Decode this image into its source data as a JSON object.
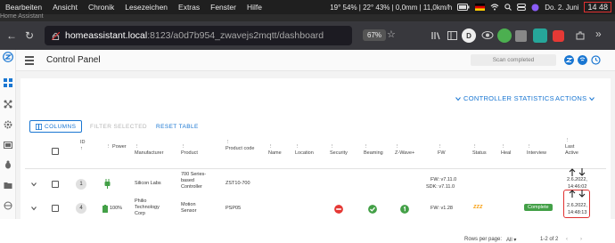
{
  "menubar": {
    "items": [
      "Bearbeiten",
      "Ansicht",
      "Chronik",
      "Lesezeichen",
      "Extras",
      "Fenster",
      "Hilfe"
    ],
    "status": "19° 54% | 22° 43% | 0,0mm | 11,0km/h",
    "date": "Do. 2. Juni",
    "time": "14 48"
  },
  "tab": {
    "title": "Home Assistant"
  },
  "browser": {
    "url_host": "homeassistant.local",
    "url_rest": ":8123/a0d7b954_zwavejs2mqtt/dashboard",
    "zoom": "67%",
    "ext_letter": "D"
  },
  "header": {
    "title": "Control Panel",
    "scan_status": "Scan completed"
  },
  "controls": {
    "stats_label": "CONTROLLER STATISTICS",
    "actions_label": "ACTIONS"
  },
  "toolbar": {
    "columns_label": "COLUMNS",
    "filter_label": "FILTER SELECTED",
    "reset_label": "RESET TABLE"
  },
  "table": {
    "headers": {
      "id": "ID",
      "power": "Power",
      "manufacturer": "Manufacturer",
      "product": "Product",
      "product_code": "Product code",
      "name": "Name",
      "location": "Location",
      "security": "Security",
      "beaming": "Beaming",
      "zwave_plus": "Z-Wave+",
      "fw": "FW",
      "status": "Status",
      "heal": "Heal",
      "interview": "Interview",
      "last_active": "Last Active"
    },
    "rows": [
      {
        "id": "1",
        "power": "",
        "manufacturer": "Silicon Labs",
        "product_l1": "700 Series-",
        "product_l2": "based",
        "product_l3": "Controller",
        "product_code": "ZST10-700",
        "fw_l1": "FW: v7.11.0",
        "fw_l2": "SDK: v7.11.0",
        "last_l1": "2.6.2022,",
        "last_l2": "14:46:02"
      },
      {
        "id": "4",
        "power": "100%",
        "manufacturer_l1": "Philio",
        "manufacturer_l2": "Technology",
        "manufacturer_l3": "Corp",
        "product_l1": "Motion",
        "product_l2": "Sensor",
        "product_code": "PSP05",
        "fw": "FW: v1.28",
        "status": "zzz",
        "interview": "Complete",
        "last_l1": "2.6.2022,",
        "last_l2": "14:48:13"
      }
    ]
  },
  "footer": {
    "rows_per_page_label": "Rows per page:",
    "rows_per_page_value": "All",
    "range": "1-2 of 2"
  },
  "colors": {
    "accent": "#1976d2",
    "menubar_bg": "#1f1f1f",
    "urlbar_bg": "#38383d",
    "highlight": "#e03030",
    "ok_green": "#43a047",
    "error_red": "#e53935"
  }
}
